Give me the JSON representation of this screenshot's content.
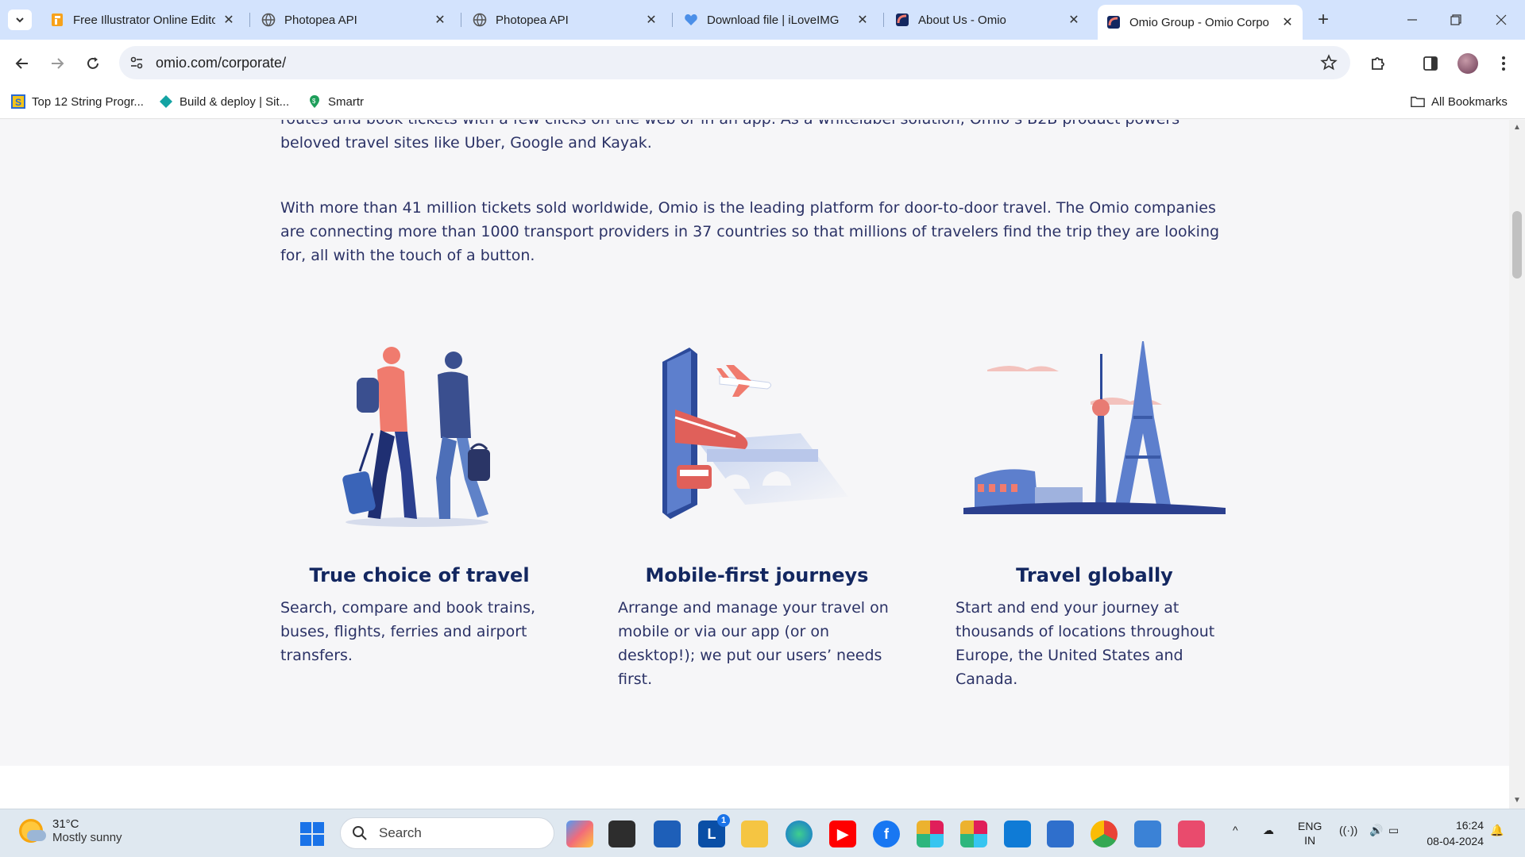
{
  "browser": {
    "tabs": [
      {
        "title": "Free Illustrator Online Edito",
        "icon": "illustrator-favicon"
      },
      {
        "title": "Photopea API",
        "icon": "globe-icon"
      },
      {
        "title": "Photopea API",
        "icon": "globe-icon"
      },
      {
        "title": "Download file | iLoveIMG",
        "icon": "heart-favicon"
      },
      {
        "title": "About Us - Omio",
        "icon": "omio-favicon"
      },
      {
        "title": "Omio Group - Omio Corpo",
        "icon": "omio-favicon",
        "active": true
      }
    ],
    "url": "omio.com/corporate/",
    "bookmarks": [
      {
        "label": "Top 12 String Progr...",
        "icon": "s-favicon"
      },
      {
        "label": "Build & deploy | Sit...",
        "icon": "diamond-favicon"
      },
      {
        "label": "Smartr",
        "icon": "smartr-favicon"
      }
    ],
    "all_bookmarks_label": "All Bookmarks"
  },
  "page": {
    "paragraph1": "routes and book tickets with a few clicks on the web or in an app. As a whitelabel solution, Omio’s B2B product powers beloved travel sites like Uber, Google and Kayak.",
    "paragraph2": "With more than 41 million tickets sold worldwide, Omio is the leading platform for door-to-door travel. The Omio companies are connecting more than 1000 transport providers in 37 countries so that millions of travelers find the trip they are looking for, all with the touch of a button.",
    "features": [
      {
        "title": "True choice of travel",
        "text": "Search, compare and book trains, buses, flights, ferries and airport transfers."
      },
      {
        "title": "Mobile-first journeys",
        "text": "Arrange and manage your travel on mobile or via our app (or on desktop!); we put our users’ needs first."
      },
      {
        "title": "Travel globally",
        "text": "Start and end your journey at thousands of locations throughout Europe, the United States and Canada."
      }
    ]
  },
  "taskbar": {
    "weather_temp": "31°C",
    "weather_desc": "Mostly sunny",
    "search_placeholder": "Search",
    "lang1": "ENG",
    "lang2": "IN",
    "time": "16:24",
    "date": "08-04-2024",
    "linkedin_badge": "1"
  },
  "colors": {
    "accent_navy": "#132760",
    "text": "#2b3266",
    "coral": "#f07b6e",
    "tabstrip": "#d3e3fd"
  }
}
